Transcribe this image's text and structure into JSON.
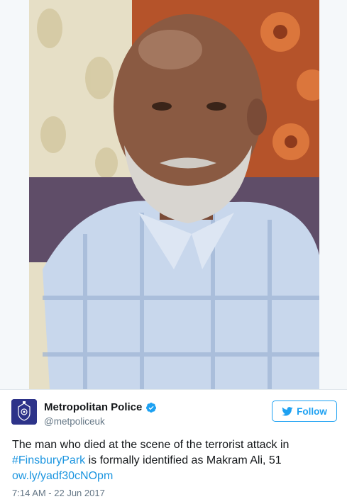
{
  "photo": {
    "icon": "portrait-photo",
    "colors": {
      "wallpaper": "#e6dfc6",
      "curtain": "#b5532a",
      "shirt": "#c8d7ec",
      "skin": "#8a5a42"
    }
  },
  "tweet": {
    "author": {
      "name": "Metropolitan Police",
      "handle": "@metpoliceuk",
      "avatar_icon": "police-crest-icon",
      "verified_icon": "verified-badge-icon"
    },
    "follow_button": {
      "label": "Follow",
      "icon": "twitter-bird-icon"
    },
    "text": {
      "part1": "The man who died at the scene of the terrorist attack in",
      "hashtag": "#FinsburyPark",
      "part2": " is formally identified as Makram Ali, 51",
      "link": "ow.ly/yadf30cNOpm"
    },
    "timestamp": "7:14 AM - 22 Jun 2017"
  },
  "colors": {
    "accent": "#1da1f2",
    "link": "#1b95e0",
    "secondary_text": "#657786"
  }
}
